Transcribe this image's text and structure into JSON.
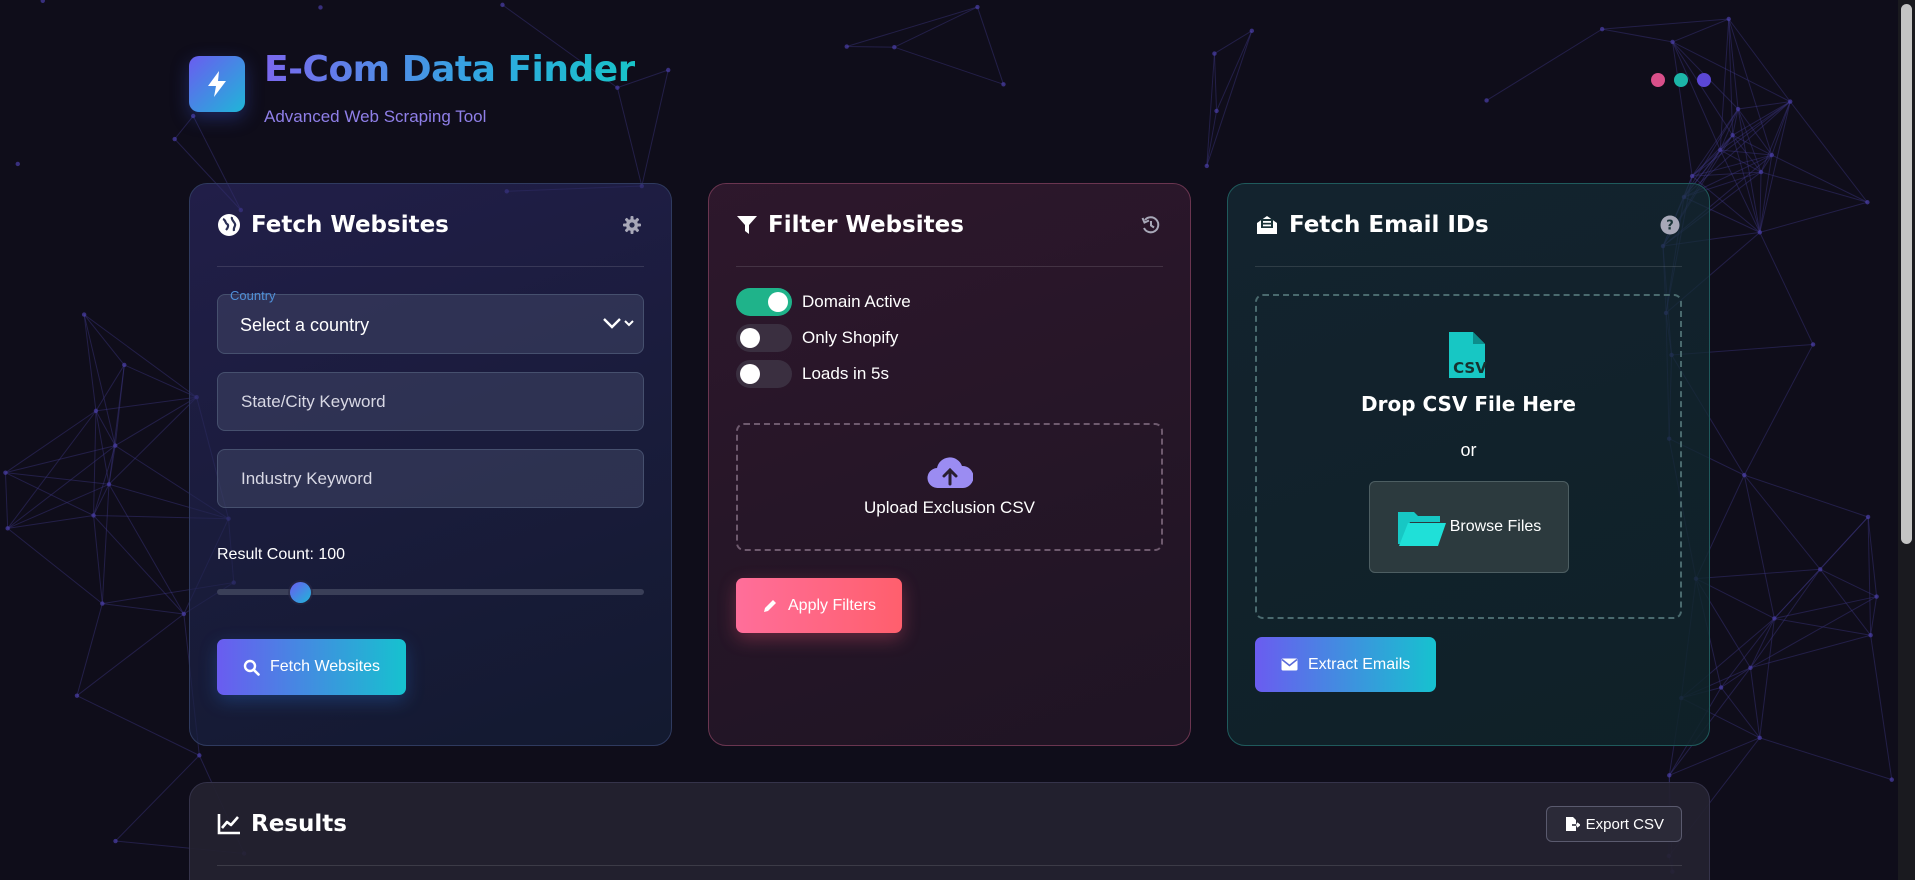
{
  "app": {
    "title": "E-Com Data Finder",
    "subtitle": "Advanced Web Scraping Tool"
  },
  "window_dots": {
    "colors": [
      "#d94f8a",
      "#1cb5a8",
      "#5b47d6"
    ]
  },
  "fetch_websites": {
    "title": "Fetch Websites",
    "header_icon": "gear-icon",
    "country_label": "Country",
    "country_value": "Select a country",
    "state_placeholder": "State/City Keyword",
    "industry_placeholder": "Industry Keyword",
    "result_count_label": "Result Count: 100",
    "result_count": 100,
    "slider_fraction": 0.2,
    "button_label": "Fetch Websites"
  },
  "filter_websites": {
    "title": "Filter Websites",
    "header_icon": "history-icon",
    "toggles": [
      {
        "label": "Domain Active",
        "on": true
      },
      {
        "label": "Only Shopify",
        "on": false
      },
      {
        "label": "Loads in 5s",
        "on": false
      }
    ],
    "upload_label": "Upload Exclusion CSV",
    "button_label": "Apply Filters"
  },
  "fetch_emails": {
    "title": "Fetch Email IDs",
    "header_icon": "help-icon",
    "drop_title": "Drop CSV File Here",
    "or_text": "or",
    "browse_label": "Browse Files",
    "button_label": "Extract Emails"
  },
  "results": {
    "title": "Results",
    "export_label": "Export CSV"
  },
  "colors": {
    "accent_gradient_start": "#6a5cf0",
    "accent_gradient_end": "#16c2cf",
    "apply_gradient_start": "#ff6e9a",
    "apply_gradient_end": "#ff5f6d",
    "toggle_on": "#1fb38a"
  }
}
